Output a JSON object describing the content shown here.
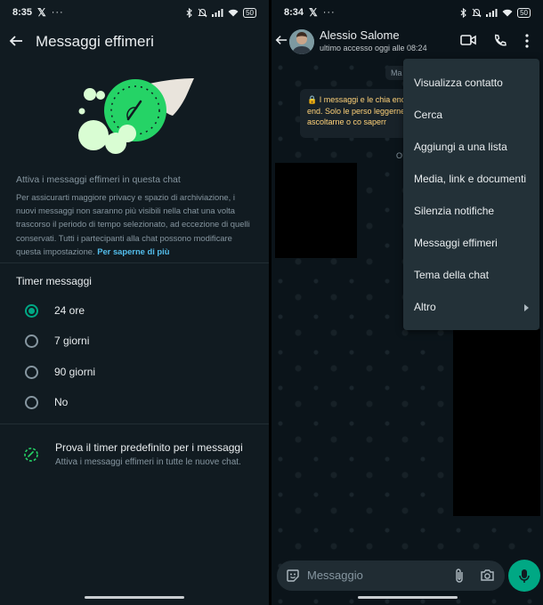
{
  "left_screen": {
    "status_bar": {
      "time": "8:35",
      "x_glyph": "𝕏",
      "dots": "···",
      "battery": "50"
    },
    "header": {
      "title": "Messaggi effimeri"
    },
    "info": {
      "title": "Attiva i messaggi effimeri in questa chat",
      "body": "Per assicurarti maggiore privacy e spazio di archiviazione, i nuovi messaggi non saranno più visibili nella chat una volta trascorso il periodo di tempo selezionato, ad eccezione di quelli conservati. Tutti i partecipanti alla chat possono modificare questa impostazione.",
      "link": "Per saperne di più"
    },
    "timer": {
      "label": "Timer messaggi",
      "options": [
        {
          "label": "24 ore",
          "selected": true
        },
        {
          "label": "7 giorni",
          "selected": false
        },
        {
          "label": "90 giorni",
          "selected": false
        },
        {
          "label": "No",
          "selected": false
        }
      ]
    },
    "default_timer": {
      "title": "Prova il timer predefinito per i messaggi",
      "subtitle": "Attiva i messaggi effimeri in tutte le nuove chat."
    }
  },
  "right_screen": {
    "status_bar": {
      "time": "8:34",
      "x_glyph": "𝕏",
      "dots": "···",
      "battery": "50"
    },
    "header": {
      "contact_name": "Alessio Salome",
      "last_seen": "ultimo accesso oggi alle 08:24"
    },
    "chat": {
      "date_chip": "Ma",
      "system_message": "🔒 I messaggi e le chia end-to-end. Solo le perso leggerne, ascoltarne o co saperr",
      "small_chip": "O"
    },
    "menu": {
      "items": [
        "Visualizza contatto",
        "Cerca",
        "Aggiungi a una lista",
        "Media, link e documenti",
        "Silenzia notifiche",
        "Messaggi effimeri",
        "Tema della chat",
        "Altro"
      ]
    },
    "input": {
      "placeholder": "Messaggio"
    }
  },
  "colors": {
    "accent": "#00a884",
    "link": "#53bdeb",
    "background": "#111b21",
    "menu": "#233138",
    "system_text": "#ffd279"
  }
}
